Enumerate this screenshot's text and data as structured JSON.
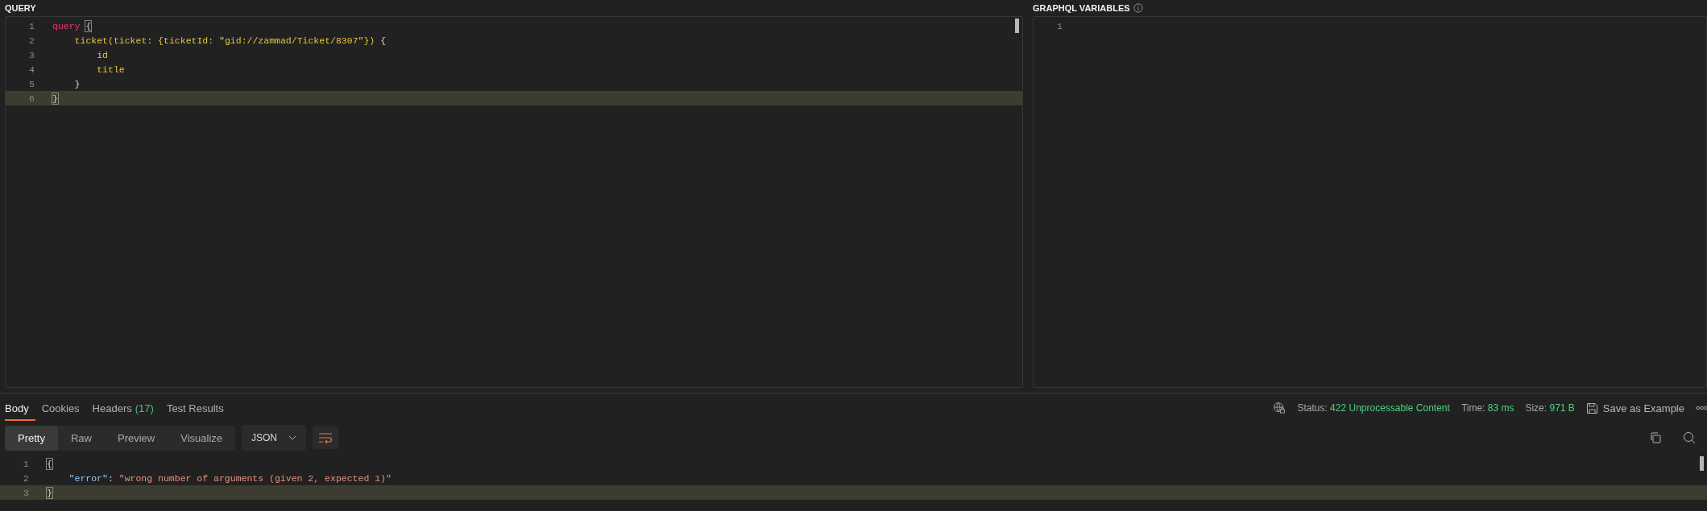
{
  "query_panel": {
    "title": "QUERY",
    "lines": [
      {
        "number": "1",
        "active": false,
        "tokens": [
          {
            "kind": "keyword",
            "text": "query"
          },
          {
            "kind": "match",
            "text": "{"
          }
        ]
      },
      {
        "number": "2",
        "active": false,
        "tokens": [
          {
            "kind": "field",
            "text": "    ticket(ticket: {ticketId: \"gid://zammad/Ticket/8307\"})"
          },
          {
            "kind": "plain",
            "text": " {"
          }
        ]
      },
      {
        "number": "3",
        "active": false,
        "tokens": [
          {
            "kind": "field",
            "text": "        id"
          }
        ]
      },
      {
        "number": "4",
        "active": false,
        "tokens": [
          {
            "kind": "field",
            "text": "        title"
          }
        ]
      },
      {
        "number": "5",
        "active": false,
        "tokens": [
          {
            "kind": "plain",
            "text": "    }"
          }
        ]
      },
      {
        "number": "6",
        "active": true,
        "tokens": [
          {
            "kind": "match",
            "text": "}"
          }
        ]
      }
    ]
  },
  "variables_panel": {
    "title": "GRAPHQL VARIABLES",
    "lines": [
      {
        "number": "1",
        "active": false
      }
    ]
  },
  "response": {
    "tabs": [
      {
        "label": "Body",
        "selected": true
      },
      {
        "label": "Cookies",
        "selected": false
      },
      {
        "label": "Headers",
        "count": "(17)",
        "selected": false
      },
      {
        "label": "Test Results",
        "selected": false
      }
    ],
    "status": [
      {
        "label": "Status:",
        "value": "422 Unprocessable Content"
      },
      {
        "label": "Time:",
        "value": "83 ms"
      },
      {
        "label": "Size:",
        "value": "971 B"
      }
    ],
    "save_button": "Save as Example",
    "views": [
      {
        "label": "Pretty",
        "selected": true
      },
      {
        "label": "Raw",
        "selected": false
      },
      {
        "label": "Preview",
        "selected": false
      },
      {
        "label": "Visualize",
        "selected": false
      }
    ],
    "format": "JSON",
    "lines": [
      {
        "number": "1",
        "active": false,
        "tokens": [
          {
            "kind": "match",
            "text": "{"
          }
        ]
      },
      {
        "number": "2",
        "active": false,
        "tokens": [
          {
            "kind": "key",
            "text": "    \"error\""
          },
          {
            "kind": "plain",
            "text": ": "
          },
          {
            "kind": "string",
            "text": "\"wrong number of arguments (given 2, expected 1)\""
          }
        ]
      },
      {
        "number": "3",
        "active": true,
        "tokens": [
          {
            "kind": "match",
            "text": "}"
          }
        ]
      }
    ]
  }
}
